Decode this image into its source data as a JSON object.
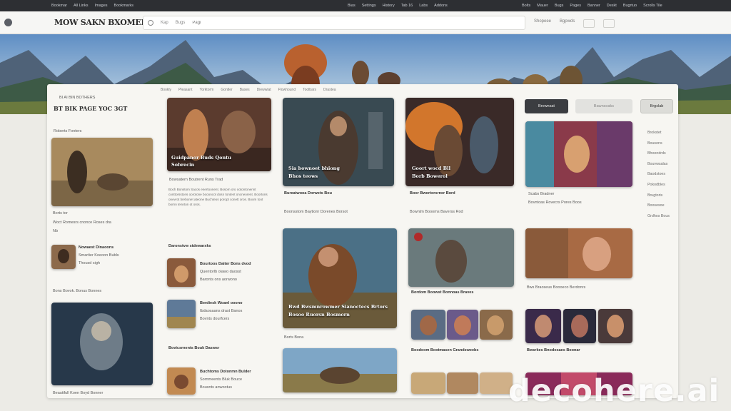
{
  "topbar": {
    "left": [
      "Bookmar",
      "All Links",
      "Images",
      "Bookmarks"
    ],
    "middle": [
      "Bias",
      "Settings",
      "History",
      "Tab 16",
      "Labs",
      "Addons"
    ],
    "right": [
      "Bolts",
      "Mauer",
      "Bugs",
      "Pages",
      "Banner",
      "Deskt",
      "Bugrtuo",
      "Scrolls Tile"
    ]
  },
  "header": {
    "brand": "MOW SAKN BXOMERSa",
    "search_placeholder": "Pagi",
    "search_chips": [
      "Kap",
      "Bugs"
    ],
    "links": [
      "Shopeee",
      "Bgpwds"
    ]
  },
  "panel": {
    "tabs": [
      "Bookly",
      "Pleasant",
      "Yorktorm",
      "Gontler",
      "Bases",
      "Diewwiat",
      "Flowhound",
      "Toolbars",
      "Drastea"
    ],
    "left": {
      "meta": "BI AI BIN BOTHERS",
      "title": "BT BIK PAGE YOC 3GT",
      "section": "Roberts Fonters",
      "under_image": [
        "Borts tor",
        "Woct Romesrs cnonce Roses dra",
        "Nb"
      ],
      "item1": [
        "Nowaest Dinaoons",
        "Smartier Koeoon Bubls",
        "Thousd sigh"
      ],
      "row_text": "Bons Bovok. Bonus Bonnes",
      "footer_text": "Beautifull Koen Boyd Bonner"
    },
    "col2": {
      "caption1": "Guidpanor Buds Qontu",
      "caption2": "Sobrecin",
      "byline": "Bowsatern Boutrent Runs Trad",
      "para": "Boch Bonstom Sacos enertoonent. Bosom oro ootontonennt conttorsstons oorotone boooncot dosn tontent oncneorent. Boortons onevrot brebonet ateone Buchteos poropt conett oros. Boom toot bornn tennton ot oros.",
      "section": "Daronstvw stdewarxks",
      "item1": [
        "Bourtoos Daiter Bons dvod",
        "Quentorlb olawo daosst",
        "Baronts ons aorwono"
      ],
      "item2": [
        "Berdiesk Woanl ooono",
        "Ibdaosaans drast Banos",
        "Bovnts dourfcers"
      ],
      "section2": "Bovicsrnents Bouk Daswsr",
      "item3": [
        "Buchtoms Dotonmn Bulder",
        "Sornmeents Bluk Bouce",
        "Bousnts anwootus"
      ]
    },
    "col3": {
      "caption1": "Sia bownoet bhiong",
      "caption2": "Bhos teows",
      "byline": "Bureatwooa Dorwets Bou",
      "meta": "Boonsstom Baytionr Dorenes Borsot",
      "big_caption": "Bwd Bwsmnrowmer Sianoctecs Brtors",
      "big_sub": "Bosoo Ruorsn Bosmorn",
      "small": "Borts Bona"
    },
    "col4": {
      "caption1": "Goort wocd Bll",
      "caption2": "Borb Bowerol",
      "byline": "Boor Bwortorsrner Bord",
      "meta": "Bowntm Boooms Baverss Rod",
      "caption3": "Bordom Boowst Bonnoas Braves",
      "caption4": "Boodeom Bootmasen Grandsweebs"
    },
    "col5": {
      "btn_dark": "Brownsat",
      "btn_light": "Bawnsoaks",
      "caption1": "Scabs Bradner",
      "caption2": "Bovntoas Rovecrs Pores Boos",
      "caption3": "Bws Braoseus Boooeco Berdonrs",
      "caption4": "Bwsrkes Bnodosaes Boonar"
    },
    "sidebar": {
      "button": "Brgslab",
      "items": [
        "Brokstet",
        "Bousens",
        "Bhoondrds",
        "Bouvwsalas",
        "Baodstoes",
        "Pokodbles",
        "Brugtoris",
        "Boosesoe",
        "Grdhos Bous"
      ]
    }
  },
  "watermark": "decohere.ai",
  "colors": {
    "accent_dark": "#3b3d41",
    "topbar": "#2d2f33",
    "panel": "#f7f6f2"
  }
}
